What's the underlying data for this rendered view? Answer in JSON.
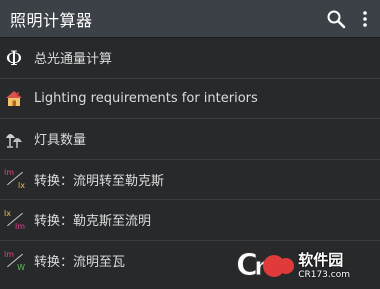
{
  "appbar": {
    "title": "照明计算器",
    "search_icon": "search-icon",
    "more_icon": "more-vert-icon",
    "bg": "#3c4147"
  },
  "items": [
    {
      "label": "总光通量计算",
      "icon": "phi-icon"
    },
    {
      "label": "Lighting requirements for interiors",
      "icon": "house-icon"
    },
    {
      "label": "灯具数量",
      "icon": "lamp-icon"
    },
    {
      "label": "转换：流明转至勒克斯",
      "icon": "lm-lx-icon",
      "from": "lm",
      "to": "lx"
    },
    {
      "label": "转换：勒克斯至流明",
      "icon": "lx-lm-icon",
      "from": "lx",
      "to": "lm"
    },
    {
      "label": "转换：流明至瓦",
      "icon": "lm-w-icon",
      "from": "lm",
      "to": "W"
    }
  ],
  "watermark": {
    "main": "软件园",
    "sub": "CR173.com"
  },
  "colors": {
    "background": "#27292b",
    "divider": "#3a3d40",
    "accent_pink": "#e6418c",
    "accent_yellow": "#f0c040"
  }
}
